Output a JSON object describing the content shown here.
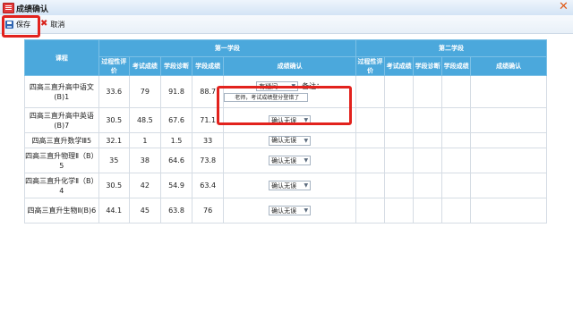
{
  "window": {
    "title": "成绩确认",
    "close_glyph": "✕"
  },
  "toolbar": {
    "save_label": "保存",
    "cancel_label": "取消"
  },
  "table": {
    "col_course": "课程",
    "semesters": [
      "第一学段",
      "第二学段"
    ],
    "metric_headers": [
      "过程性评价",
      "考试成绩",
      "学段诊断",
      "学段成绩"
    ],
    "confirm_header": "成绩确认",
    "rows": [
      {
        "course": "四高三直升高中语文(B)1",
        "values": [
          "33.6",
          "79",
          "91.8",
          "88.7"
        ],
        "confirm": "有疑问",
        "note_label": "备注：",
        "note_value": "老师，考试成绩登分登错了"
      },
      {
        "course": "四高三直升高中英语(B)7",
        "values": [
          "30.5",
          "48.5",
          "67.6",
          "71.1"
        ],
        "confirm": "确认无误"
      },
      {
        "course": "四高三直升数学Ⅲ5",
        "values": [
          "32.1",
          "1",
          "1.5",
          "33"
        ],
        "confirm": "确认无误"
      },
      {
        "course": "四高三直升物理Ⅱ（B）5",
        "values": [
          "35",
          "38",
          "64.6",
          "73.8"
        ],
        "confirm": "确认无误"
      },
      {
        "course": "四高三直升化学Ⅱ（B）4",
        "values": [
          "30.5",
          "42",
          "54.9",
          "63.4"
        ],
        "confirm": "确认无误"
      },
      {
        "course": "四高三直升生物Ⅱ(B)6",
        "values": [
          "44.1",
          "45",
          "63.8",
          "76"
        ],
        "confirm": "确认无误"
      }
    ]
  }
}
